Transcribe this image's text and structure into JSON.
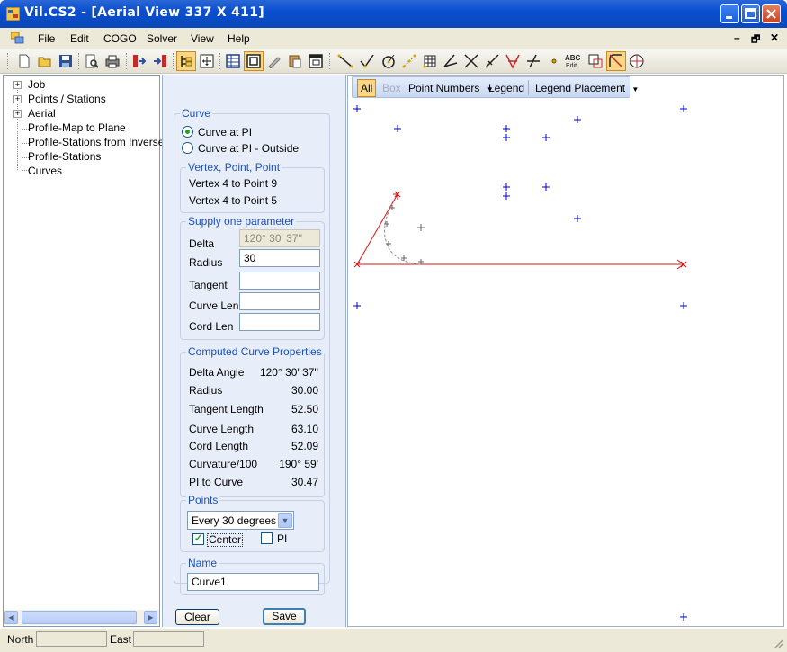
{
  "window": {
    "title": "Vil.CS2 - [Aerial View   337  X  411]",
    "mdi_min": "–",
    "mdi_restore": "🗗",
    "mdi_close": "✕"
  },
  "menu": [
    "File",
    "Edit",
    "COGO",
    "Solver",
    "View",
    "Help"
  ],
  "tree": {
    "items": [
      {
        "label": "Job",
        "expandable": true
      },
      {
        "label": "Points / Stations",
        "expandable": true
      },
      {
        "label": "Aerial",
        "expandable": true
      },
      {
        "label": "Profile-Map to Plane",
        "expandable": false
      },
      {
        "label": "Profile-Stations from Inverse",
        "expandable": false
      },
      {
        "label": "Profile-Stations",
        "expandable": false
      },
      {
        "label": "Curves",
        "expandable": false
      }
    ]
  },
  "curve_group": {
    "title": "Curve",
    "options": [
      "Curve at PI",
      "Curve at PI - Outside"
    ],
    "selected": 0
  },
  "vertex_group": {
    "title": "Vertex, Point, Point",
    "lines": [
      "Vertex 4 to Point 9",
      "Vertex 4 to Point 5"
    ]
  },
  "supply_group": {
    "title": "Supply one parameter",
    "fields": [
      {
        "label": "Delta",
        "value": "120° 30' 37''",
        "disabled": true
      },
      {
        "label": "Radius",
        "value": "30",
        "disabled": false
      },
      {
        "label": "Tangent",
        "value": "",
        "disabled": false
      },
      {
        "label": "Curve Len",
        "value": "",
        "disabled": false
      },
      {
        "label": "Cord Len",
        "value": "",
        "disabled": false
      }
    ]
  },
  "computed_group": {
    "title": "Computed Curve Properties",
    "rows": [
      {
        "label": "Delta Angle",
        "value": "120° 30' 37''"
      },
      {
        "label": "Radius",
        "value": "30.00"
      },
      {
        "label": "Tangent Length",
        "value": "52.50"
      },
      {
        "label": "Curve Length",
        "value": "63.10"
      },
      {
        "label": "Cord Length",
        "value": "52.09"
      },
      {
        "label": "Curvature/100",
        "value": "190° 59'"
      },
      {
        "label": "PI to Curve",
        "value": "30.47"
      }
    ]
  },
  "points_group": {
    "title": "Points",
    "select_value": "Every 30 degrees",
    "center_label": "Center",
    "center_checked": true,
    "pi_label": "PI",
    "pi_checked": false
  },
  "name_group": {
    "title": "Name",
    "value": "Curve1"
  },
  "buttons": {
    "clear": "Clear",
    "save": "Save"
  },
  "viewbar": {
    "all": "All",
    "box": "Box",
    "point_numbers": "Point Numbers",
    "legend": "Legend",
    "legend_placement": "Legend Placement"
  },
  "status": {
    "north_label": "North",
    "north_value": "",
    "east_label": "East",
    "east_value": ""
  },
  "colors": {
    "point_marker": "#0000cc",
    "line_red": "#dd1111",
    "curve_grey": "#777777",
    "accent": "#1a50b8"
  },
  "toolbar_icons": [
    "new-icon",
    "open-icon",
    "save-icon",
    "print-preview-icon",
    "print-icon",
    "import-icon",
    "export-icon",
    "tree-view-icon",
    "fit-view-icon",
    "grid-icon",
    "layout-icon",
    "pen-icon",
    "paste-icon",
    "window-icon",
    "line-icon",
    "check-line-icon",
    "circle-tool-icon",
    "dots-icon",
    "table-icon",
    "angle-icon",
    "intersect-icon",
    "traverse-icon",
    "split-icon",
    "offset-icon",
    "point-icon",
    "abc-edit-icon",
    "zoom-icon",
    "curve-tool-icon",
    "globe-icon"
  ]
}
